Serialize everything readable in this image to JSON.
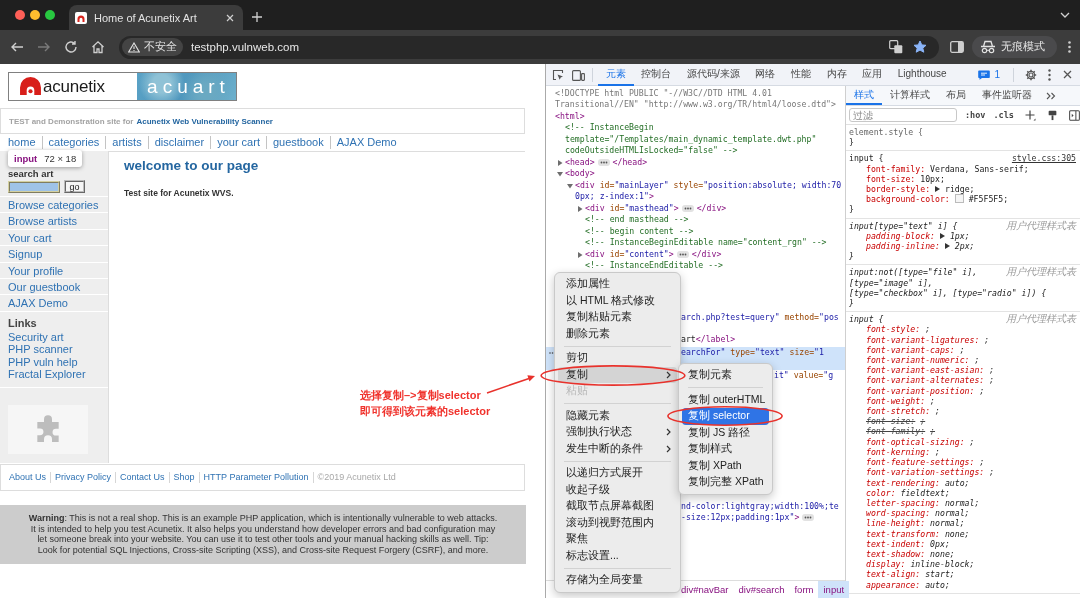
{
  "browser": {
    "tabs": [
      {
        "title": "Home of Acunetix Art",
        "selected": true
      }
    ],
    "security_label": "不安全",
    "url": "testphp.vulnweb.com",
    "forward_disabled": true,
    "bookmarked": true,
    "profile_label": "无痕模式"
  },
  "page": {
    "logo": {
      "brand": "acunetix",
      "product": "acuart"
    },
    "tagline": {
      "text": "TEST and Demonstration site for",
      "link": "Acunetix Web Vulnerability Scanner"
    },
    "nav": [
      "home",
      "categories",
      "artists",
      "disclaimer",
      "your cart",
      "guestbook",
      "AJAX Demo"
    ],
    "inspect_tooltip": {
      "tag": "input",
      "size": "72 × 18"
    },
    "search": {
      "label": "search art",
      "button": "go",
      "highlighted": true
    },
    "categories": [
      "Browse categories",
      "Browse artists",
      "Your cart",
      "Signup",
      "Your profile",
      "Our guestbook",
      "AJAX Demo"
    ],
    "links_heading": "Links",
    "links": [
      "Security art",
      "PHP scanner",
      "PHP vuln help",
      "Fractal Explorer"
    ],
    "heading": "welcome to our page",
    "intro": "Test site for Acunetix WVS.",
    "footer_links": [
      "About Us",
      "Privacy Policy",
      "Contact Us",
      "Shop",
      "HTTP Parameter Pollution"
    ],
    "copyright": "©2019 Acunetix Ltd",
    "warning": "**Warning**: This is not a real shop. This is an example PHP application, which is intentionally vulnerable to web attacks. It is intended to help you test Acunetix. It also helps you understand how developer errors and bad configuration may let someone break into your website. You can use it to test other tools and your manual hacking skills as well. Tip: Look for potential SQL Injections, Cross-site Scripting (XSS), and Cross-site Request Forgery (CSRF), and more."
  },
  "annotation": {
    "lines": [
      "选择复制–>复制selector",
      "即可得到该元素的selector"
    ]
  },
  "devtools": {
    "tabs": [
      {
        "label": "元素",
        "selected": true
      },
      {
        "label": "控制台",
        "selected": false
      },
      {
        "label": "源代码/来源",
        "selected": false
      },
      {
        "label": "网络",
        "selected": false
      },
      {
        "label": "性能",
        "selected": false
      },
      {
        "label": "内存",
        "selected": false
      },
      {
        "label": "应用",
        "selected": false
      },
      {
        "label": "Lighthouse",
        "selected": false
      }
    ],
    "message_count": "1",
    "dom": [
      {
        "kind": "doctype",
        "text": "<!DOCTYPE html PUBLIC \"-//W3C//DTD HTML 4.01 Transitional//EN\" \"http://www.w3.org/TR/html4/loose.dtd\">"
      },
      {
        "kind": "element",
        "tokens": [
          {
            "kind": "tag",
            "text": "<html>"
          }
        ],
        "children": [
          {
            "kind": "comment",
            "text": "<!-- InstanceBegin template=\"/Templates/main_dynamic_template.dwt.php\" codeOutsideHTMLIsLocked=\"false\" -->"
          },
          {
            "kind": "element",
            "expanded": false,
            "tokens": [
              {
                "kind": "tag",
                "text": "<head>"
              }
            ],
            "end_tag": "</head>"
          },
          {
            "kind": "element",
            "expanded": true,
            "tokens": [
              {
                "kind": "tag",
                "text": "<body>"
              }
            ],
            "children": [
              {
                "kind": "element",
                "expanded": true,
                "tokens": [
                  {
                    "kind": "tag",
                    "text": "<div"
                  },
                  {
                    "kind": "attr",
                    "text": " id="
                  },
                  {
                    "kind": "value",
                    "text": "\"mainLayer\""
                  },
                  {
                    "kind": "attr",
                    "text": " style="
                  },
                  {
                    "kind": "value",
                    "text": "\"position:absolute; width:700px; z-index:1\""
                  },
                  {
                    "kind": "tag",
                    "text": ">"
                  }
                ],
                "children": [
                  {
                    "kind": "element",
                    "expanded": false,
                    "tokens": [
                      {
                        "kind": "tag",
                        "text": "<div"
                      },
                      {
                        "kind": "attr",
                        "text": " id="
                      },
                      {
                        "kind": "value",
                        "text": "\"masthead\""
                      },
                      {
                        "kind": "tag",
                        "text": ">"
                      }
                    ],
                    "end_tag": "</div>"
                  },
                  {
                    "kind": "comment",
                    "text": "<!-- end masthead -->"
                  },
                  {
                    "kind": "comment",
                    "text": "<!-- begin content -->"
                  },
                  {
                    "kind": "comment",
                    "text": "<!-- InstanceBeginEditable name=\"content_rgn\" -->"
                  },
                  {
                    "kind": "element",
                    "expanded": false,
                    "tokens": [
                      {
                        "kind": "tag",
                        "text": "<div"
                      },
                      {
                        "kind": "attr",
                        "text": " id="
                      },
                      {
                        "kind": "value",
                        "text": "\"content\""
                      },
                      {
                        "kind": "tag",
                        "text": ">"
                      }
                    ],
                    "end_tag": "</div>"
                  },
                  {
                    "kind": "comment",
                    "text": "<!-- InstanceEndEditable -->"
                  }
                ]
              }
            ]
          }
        ]
      }
    ],
    "fragments": [
      {
        "tokens": [
          {
            "kind": "value",
            "text": "arch.php?test=query\""
          },
          {
            "kind": "attr",
            "text": " method="
          },
          {
            "kind": "value",
            "text": "\"pos"
          }
        ],
        "selected": false,
        "collapsed": false
      },
      {
        "tokens": [
          {
            "kind": "text",
            "text": "art"
          },
          {
            "kind": "tag",
            "text": "</label>"
          }
        ],
        "selected": false,
        "collapsed": false
      },
      {
        "tokens": [
          {
            "kind": "value",
            "text": "earchFor\""
          },
          {
            "kind": "attr",
            "text": " type="
          },
          {
            "kind": "value",
            "text": "\"text\""
          },
          {
            "kind": "attr",
            "text": " size="
          },
          {
            "kind": "value",
            "text": "\"1"
          }
        ],
        "selected": true,
        "collapsed": false
      },
      {
        "tokens": [
          {
            "kind": "value",
            "text": "it\""
          },
          {
            "kind": "attr",
            "text": " value="
          },
          {
            "kind": "value",
            "text": "\"g"
          }
        ],
        "selected": false,
        "collapsed": false
      },
      {
        "tokens": [
          {
            "kind": "value",
            "text": "nd-color:lightgray;width:100%;te"
          }
        ],
        "selected": false,
        "collapsed": false
      },
      {
        "tokens": [
          {
            "kind": "value",
            "text": "-size:12px;padding:1px\""
          },
          {
            "kind": "tag",
            "text": ">"
          }
        ],
        "selected": false,
        "collapsed": true
      }
    ],
    "breadcrumbs": [
      {
        "label": "div#navBar",
        "selected": false
      },
      {
        "label": "div#search",
        "selected": false
      },
      {
        "label": "form",
        "selected": false
      },
      {
        "label": "input",
        "selected": true
      }
    ],
    "context_menu": {
      "groups": [
        [
          {
            "label": "添加属性",
            "submenu": false,
            "selected": false,
            "disabled": false,
            "circled": false
          },
          {
            "label": "以 HTML 格式修改",
            "submenu": false,
            "selected": false,
            "disabled": false,
            "circled": false
          },
          {
            "label": "复制粘贴元素",
            "submenu": false,
            "selected": false,
            "disabled": false,
            "circled": false
          },
          {
            "label": "删除元素",
            "submenu": false,
            "selected": false,
            "disabled": false,
            "circled": false
          }
        ],
        [
          {
            "label": "剪切",
            "submenu": false,
            "selected": false,
            "disabled": false,
            "circled": false
          },
          {
            "label": "复制",
            "submenu": true,
            "selected": true,
            "disabled": false,
            "circled": true
          },
          {
            "label": "粘贴",
            "submenu": false,
            "selected": false,
            "disabled": true,
            "circled": false
          }
        ],
        [
          {
            "label": "隐藏元素",
            "submenu": false,
            "selected": false,
            "disabled": false,
            "circled": false
          },
          {
            "label": "强制执行状态",
            "submenu": true,
            "selected": false,
            "disabled": false,
            "circled": false
          },
          {
            "label": "发生中断的条件",
            "submenu": true,
            "selected": false,
            "disabled": false,
            "circled": false
          }
        ],
        [
          {
            "label": "以递归方式展开",
            "submenu": false,
            "selected": false,
            "disabled": false,
            "circled": false
          },
          {
            "label": "收起子级",
            "submenu": false,
            "selected": false,
            "disabled": false,
            "circled": false
          },
          {
            "label": "截取节点屏幕截图",
            "submenu": false,
            "selected": false,
            "disabled": false,
            "circled": false
          },
          {
            "label": "滚动到视野范围内",
            "submenu": false,
            "selected": false,
            "disabled": false,
            "circled": false
          },
          {
            "label": "聚焦",
            "submenu": false,
            "selected": false,
            "disabled": false,
            "circled": false
          },
          {
            "label": "标志设置...",
            "submenu": false,
            "selected": false,
            "disabled": false,
            "circled": false
          }
        ],
        [
          {
            "label": "存储为全局变量",
            "submenu": false,
            "selected": false,
            "disabled": false,
            "circled": false
          }
        ]
      ]
    },
    "submenu": {
      "groups": [
        [
          {
            "label": "复制元素",
            "submenu": false,
            "selected": false,
            "disabled": false,
            "circled": false
          }
        ],
        [
          {
            "label": "复制 outerHTML",
            "submenu": false,
            "selected": false,
            "disabled": false,
            "circled": false
          },
          {
            "label": "复制 selector",
            "submenu": false,
            "selected": true,
            "disabled": false,
            "circled": true
          },
          {
            "label": "复制 JS 路径",
            "submenu": false,
            "selected": false,
            "disabled": false,
            "circled": false
          },
          {
            "label": "复制样式",
            "submenu": false,
            "selected": false,
            "disabled": false,
            "circled": false
          },
          {
            "label": "复制 XPath",
            "submenu": false,
            "selected": false,
            "disabled": false,
            "circled": false
          },
          {
            "label": "复制完整 XPath",
            "submenu": false,
            "selected": false,
            "disabled": false,
            "circled": false
          }
        ]
      ]
    },
    "styles": {
      "tabs": [
        {
          "label": "样式",
          "selected": true
        },
        {
          "label": "计算样式",
          "selected": false
        },
        {
          "label": "布局",
          "selected": false
        },
        {
          "label": "事件监听器",
          "selected": false
        }
      ],
      "filter_placeholder": "过滤",
      "toggles": [
        ":hov",
        ".cls"
      ],
      "rules": [
        {
          "kind": "inline",
          "selector_lines": [
            "element.style {"
          ],
          "close": "}"
        },
        {
          "kind": "author",
          "selector_lines": [
            "input {"
          ],
          "source": "style.css:305",
          "close": "}",
          "declarations": [
            {
              "name": "font-family:",
              "value": "Verdana, Sans-serif;",
              "kind": "plain",
              "overridden": false
            },
            {
              "name": "font-size:",
              "value": "10px;",
              "kind": "plain",
              "overridden": false
            },
            {
              "name": "border-style:",
              "value": "ridge;",
              "kind": "shorthand",
              "overridden": false
            },
            {
              "name": "background-color:",
              "value": "#F5F5F5;",
              "kind": "color",
              "overridden": false
            }
          ]
        },
        {
          "kind": "user-agent",
          "selector_lines": [
            "input[type=\"text\" i] {"
          ],
          "source": "用户代理样式表",
          "close": "}",
          "declarations": [
            {
              "name": "padding-block:",
              "value": "1px;",
              "kind": "shorthand",
              "overridden": false
            },
            {
              "name": "padding-inline:",
              "value": "2px;",
              "kind": "shorthand",
              "overridden": false
            }
          ]
        },
        {
          "kind": "user-agent",
          "selector_lines": [
            "input:not([type=\"file\" i],",
            "[type=\"image\" i],",
            "[type=\"checkbox\" i], [type=\"radio\" i]) {"
          ],
          "source": "用户代理样式表",
          "close": "}"
        },
        {
          "kind": "user-agent",
          "selector_lines": [
            "input {"
          ],
          "source": "用户代理样式表",
          "declarations": [
            {
              "name": "font-style:",
              "value": ";",
              "kind": "plain",
              "overridden": false
            },
            {
              "name": "font-variant-ligatures:",
              "value": ";",
              "kind": "plain",
              "overridden": false
            },
            {
              "name": "font-variant-caps:",
              "value": ";",
              "kind": "plain",
              "overridden": false
            },
            {
              "name": "font-variant-numeric:",
              "value": ";",
              "kind": "plain",
              "overridden": false
            },
            {
              "name": "font-variant-east-asian:",
              "value": ";",
              "kind": "plain",
              "overridden": false
            },
            {
              "name": "font-variant-alternates:",
              "value": ";",
              "kind": "plain",
              "overridden": false
            },
            {
              "name": "font-variant-position:",
              "value": ";",
              "kind": "plain",
              "overridden": false
            },
            {
              "name": "font-weight:",
              "value": ";",
              "kind": "plain",
              "overridden": false
            },
            {
              "name": "font-stretch:",
              "value": ";",
              "kind": "plain",
              "overridden": false
            },
            {
              "name": "font-size:",
              "value": ";",
              "kind": "plain",
              "overridden": true
            },
            {
              "name": "font-family:",
              "value": ";",
              "kind": "plain",
              "overridden": true
            },
            {
              "name": "font-optical-sizing:",
              "value": ";",
              "kind": "plain",
              "overridden": false
            },
            {
              "name": "font-kerning:",
              "value": ";",
              "kind": "plain",
              "overridden": false
            },
            {
              "name": "font-feature-settings:",
              "value": ";",
              "kind": "plain",
              "overridden": false
            },
            {
              "name": "font-variation-settings:",
              "value": ";",
              "kind": "plain",
              "overridden": false
            },
            {
              "name": "text-rendering:",
              "value": "auto;",
              "kind": "plain",
              "overridden": false
            },
            {
              "name": "color:",
              "value": "fieldtext;",
              "kind": "plain",
              "overridden": false
            },
            {
              "name": "letter-spacing:",
              "value": "normal;",
              "kind": "plain",
              "overridden": false
            },
            {
              "name": "word-spacing:",
              "value": "normal;",
              "kind": "plain",
              "overridden": false
            },
            {
              "name": "line-height:",
              "value": "normal;",
              "kind": "plain",
              "overridden": false
            },
            {
              "name": "text-transform:",
              "value": "none;",
              "kind": "plain",
              "overridden": false
            },
            {
              "name": "text-indent:",
              "value": "0px;",
              "kind": "plain",
              "overridden": false
            },
            {
              "name": "text-shadow:",
              "value": "none;",
              "kind": "plain",
              "overridden": false
            },
            {
              "name": "display:",
              "value": "inline-block;",
              "kind": "plain",
              "overridden": false
            },
            {
              "name": "text-align:",
              "value": "start;",
              "kind": "plain",
              "overridden": false
            },
            {
              "name": "appearance:",
              "value": "auto;",
              "kind": "plain",
              "overridden": false
            }
          ]
        }
      ]
    }
  }
}
